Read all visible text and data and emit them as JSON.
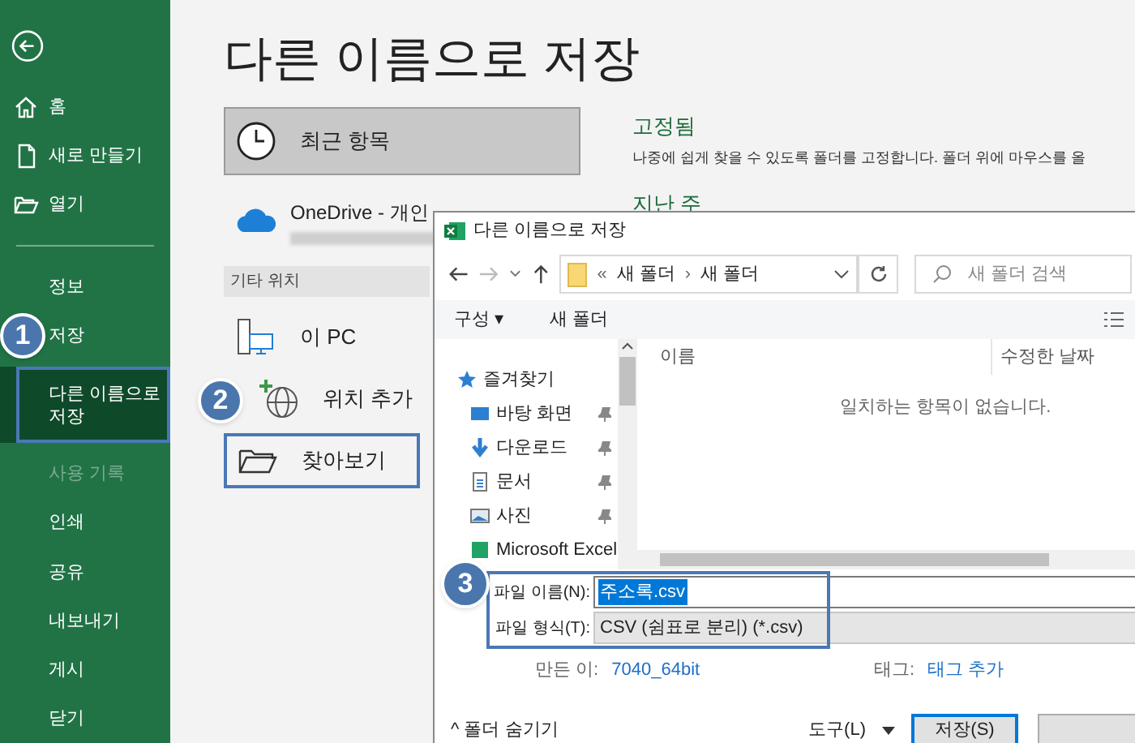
{
  "sidebar": {
    "items": [
      {
        "kind": "back"
      },
      {
        "kind": "home",
        "label": "홈",
        "selected": false,
        "disabled": false
      },
      {
        "kind": "new",
        "label": "새로 만들기",
        "selected": false,
        "disabled": false
      },
      {
        "kind": "open",
        "label": "열기",
        "selected": false,
        "disabled": false
      },
      {
        "kind": "divider"
      },
      {
        "kind": "text",
        "label": "정보",
        "selected": false,
        "disabled": false
      },
      {
        "kind": "text",
        "label": "저장",
        "selected": false,
        "disabled": false,
        "callout": "1"
      },
      {
        "kind": "text",
        "label": "다른 이름으로\n저장",
        "selected": true,
        "disabled": false
      },
      {
        "kind": "text",
        "label": "사용 기록",
        "selected": false,
        "disabled": true
      },
      {
        "kind": "text",
        "label": "인쇄",
        "selected": false,
        "disabled": false
      },
      {
        "kind": "text",
        "label": "공유",
        "selected": false,
        "disabled": false
      },
      {
        "kind": "text",
        "label": "내보내기",
        "selected": false,
        "disabled": false
      },
      {
        "kind": "text",
        "label": "게시",
        "selected": false,
        "disabled": false
      },
      {
        "kind": "text",
        "label": "닫기",
        "selected": false,
        "disabled": false
      }
    ]
  },
  "main": {
    "title": "다른 이름으로 저장",
    "locations": [
      {
        "kind": "recent",
        "label": "최근 항목",
        "selected": true,
        "highlighted": false
      },
      {
        "kind": "onedrive",
        "label": "OneDrive - 개인",
        "selected": false,
        "highlighted": false
      },
      {
        "kind": "header",
        "label": "기타 위치"
      },
      {
        "kind": "pc",
        "label": "이 PC",
        "selected": false,
        "highlighted": false
      },
      {
        "kind": "add",
        "label": "위치 추가",
        "selected": false,
        "highlighted": false,
        "callout": "2"
      },
      {
        "kind": "browse",
        "label": "찾아보기",
        "selected": false,
        "highlighted": true
      }
    ],
    "pinned": {
      "heading": "고정됨",
      "description": "나중에 쉽게 찾을 수 있도록 폴더를 고정합니다. 폴더 위에 마우스를 올"
    },
    "last_week": {
      "heading": "지난 주"
    }
  },
  "dialog": {
    "title": "다른 이름으로 저장",
    "path": [
      "«",
      "새 폴더",
      "›",
      "새 폴더"
    ],
    "search": {
      "placeholder": "새 폴더 검색"
    },
    "toolbar": {
      "organize": "구성 ▾",
      "new_folder": "새 폴더"
    },
    "nav": [
      {
        "kind": "favorites",
        "label": "즐겨찾기",
        "pinned": false
      },
      {
        "kind": "desktop",
        "label": "바탕 화면",
        "pinned": true
      },
      {
        "kind": "downloads",
        "label": "다운로드",
        "pinned": true
      },
      {
        "kind": "documents",
        "label": "문서",
        "pinned": true
      },
      {
        "kind": "pictures",
        "label": "사진",
        "pinned": true
      },
      {
        "kind": "excel",
        "label": "Microsoft Excel"
      }
    ],
    "columns": [
      "이름",
      "수정한 날짜"
    ],
    "empty_message": "일치하는 항목이 없습니다.",
    "fields": [
      {
        "label": "파일 이름(N):",
        "value": "주소록.csv",
        "kind": "input"
      },
      {
        "label": "파일 형식(T):",
        "value": "CSV (쉼표로 분리) (*.csv)",
        "kind": "select"
      }
    ],
    "fields_callout": "3",
    "meta": [
      {
        "label": "만든 이:",
        "value": "7040_64bit"
      },
      {
        "label": "태그:",
        "value": "태그 추가"
      }
    ],
    "hide_folders": "^ 폴더 숨기기",
    "tools": "도구(L)",
    "save": "저장(S)"
  }
}
